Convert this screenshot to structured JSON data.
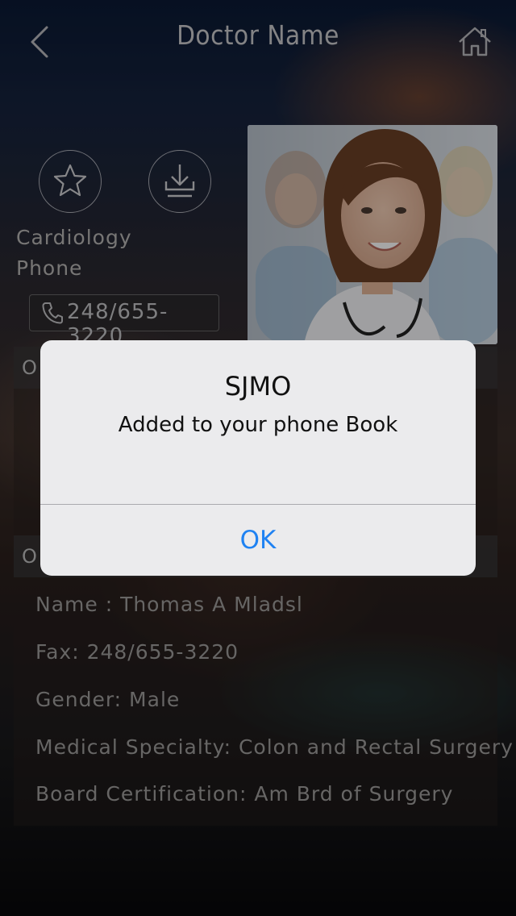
{
  "header": {
    "title": "Doctor Name"
  },
  "profile": {
    "department": "Cardiology",
    "phone_label": "Phone",
    "phone_number": "248/655-3220"
  },
  "sections": [
    {
      "title_fragment": "O"
    },
    {
      "title_fragment": "O"
    }
  ],
  "details": {
    "name": "Name : Thomas A Mladsl",
    "fax": "Fax: 248/655-3220",
    "gender": "Gender: Male",
    "specialty": "Medical Specialty: Colon and Rectal Surgery",
    "certification": "Board Certification: Am Brd of Surgery"
  },
  "alert": {
    "title": "SJMO",
    "message": "Added to your phone Book",
    "ok_label": "OK"
  },
  "colors": {
    "alert_button": "#1f82f2",
    "alert_background": "#ebebed"
  },
  "icons": [
    "back-chevron-icon",
    "home-icon",
    "star-icon",
    "download-icon",
    "phone-icon"
  ]
}
